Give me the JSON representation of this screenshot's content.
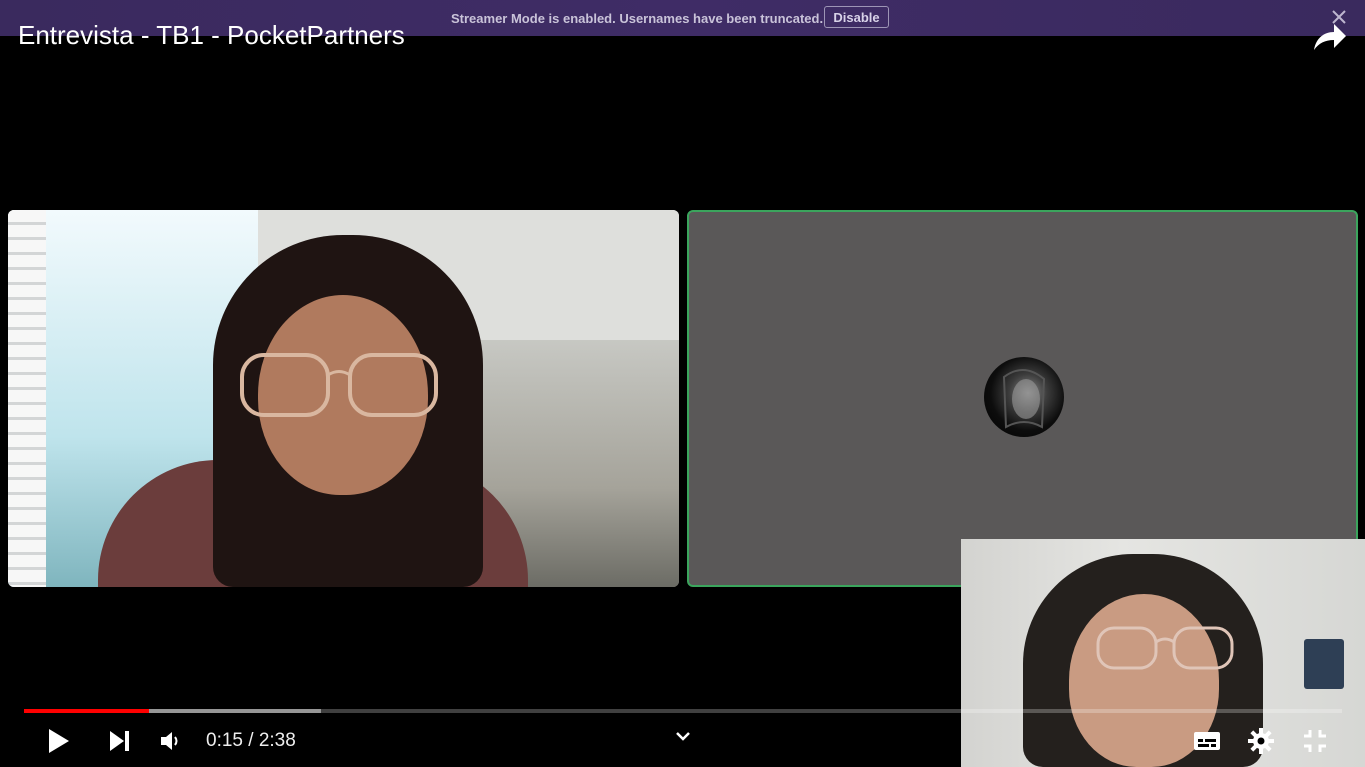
{
  "banner": {
    "message": "Streamer Mode is enabled. Usernames have been truncated.",
    "disable_label": "Disable"
  },
  "video": {
    "title": "Entrevista - TB1 - PocketPartners",
    "current_time": "0:15",
    "duration": "2:38",
    "time_display": "0:15 / 2:38",
    "played_fraction": 0.095,
    "buffered_fraction": 0.225
  },
  "colors": {
    "progress_played": "#ff0000",
    "speaking_border": "#3ba55d",
    "banner": "#3f2c66"
  },
  "icons": [
    "close-icon",
    "share-icon",
    "play-icon",
    "next-icon",
    "volume-icon",
    "chevron-down-icon",
    "subtitles-icon",
    "settings-icon",
    "exit-fullscreen-icon"
  ]
}
